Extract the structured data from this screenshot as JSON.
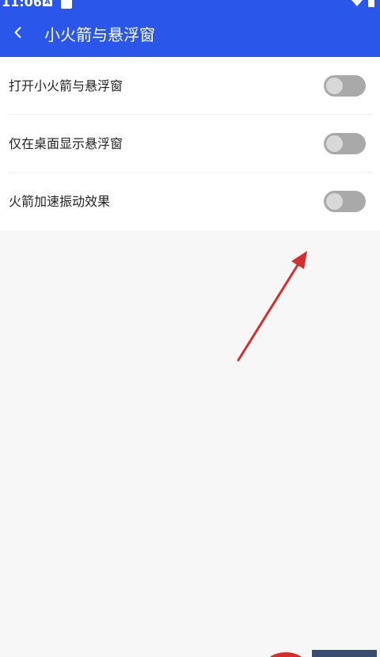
{
  "status_bar": {
    "time": "11:06",
    "notification_letter": "A"
  },
  "header": {
    "title": "小火箭与悬浮窗"
  },
  "settings": [
    {
      "label": "打开小火箭与悬浮窗",
      "enabled": false
    },
    {
      "label": "仅在桌面显示悬浮窗",
      "enabled": false
    },
    {
      "label": "火箭加速振动效果",
      "enabled": false
    }
  ],
  "icons": {
    "back": "chevron-left-icon",
    "wifi": "wifi-icon",
    "battery": "battery-icon"
  },
  "colors": {
    "header": "#2a57ea",
    "background": "#f7f7f7",
    "card": "#ffffff",
    "switch_track": "#a9a9a9",
    "switch_knob": "#d8d8d8",
    "annotation_arrow": "#d32f2f"
  }
}
